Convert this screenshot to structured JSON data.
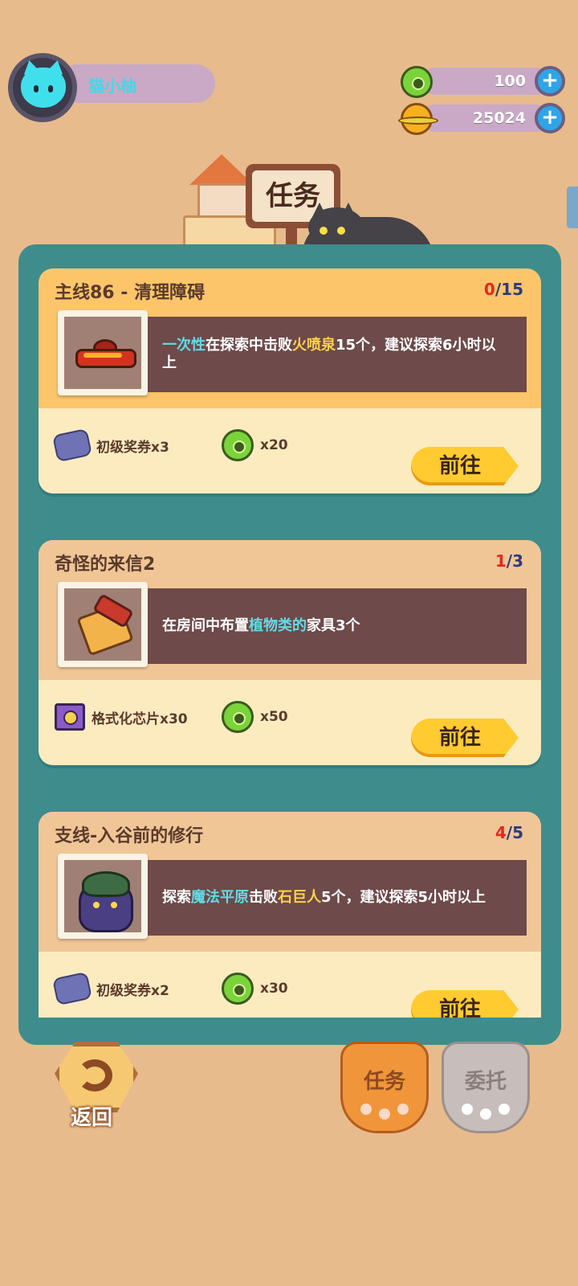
{
  "player": {
    "name": "猫小柚"
  },
  "currencies": [
    {
      "icon": "green-donut-coin-icon",
      "value": "100"
    },
    {
      "icon": "gold-planet-coin-icon",
      "value": "25024"
    }
  ],
  "header": {
    "sign_title": "任务"
  },
  "tasks": [
    {
      "title": "主线86 - 清理障碍",
      "progress_current": "0",
      "progress_sep": "/",
      "progress_total": "15",
      "item_icon": "fire-geyser-icon",
      "desc": [
        "一次性",
        "在探索中击败",
        "火喷泉",
        "15个，建议探索6小时以上"
      ],
      "rewards": [
        {
          "icon": "ticket-icon",
          "label": "初级奖券x3"
        },
        {
          "icon": "green-donut-coin-icon",
          "label": "x20"
        }
      ],
      "go_label": "前往"
    },
    {
      "title": "奇怪的来信2",
      "progress_current": "1",
      "progress_sep": "/",
      "progress_total": "3",
      "item_icon": "paint-roller-icon",
      "desc": [
        "在房间中布置",
        "植物类的",
        "家具3个"
      ],
      "rewards": [
        {
          "icon": "format-chip-icon",
          "label": "格式化芯片x30"
        },
        {
          "icon": "green-donut-coin-icon",
          "label": "x50"
        }
      ],
      "go_label": "前往"
    },
    {
      "title": "支线-入谷前的修行",
      "progress_current": "4",
      "progress_sep": "/",
      "progress_total": "5",
      "item_icon": "stone-golem-icon",
      "desc": [
        "探索",
        "魔法平原",
        "击败",
        "石巨人",
        "5个，建议探索5小时以上"
      ],
      "rewards": [
        {
          "icon": "ticket-icon",
          "label": "初级奖券x2"
        },
        {
          "icon": "green-donut-coin-icon",
          "label": "x30"
        }
      ],
      "go_label": "前往"
    }
  ],
  "nav": {
    "back_label": "返回",
    "task_label": "任务",
    "commission_label": "委托"
  },
  "colors": {
    "background": "#e8bb8c",
    "panel": "#3e8c8c",
    "progress_current": "#e8271f",
    "highlight_cyan": "#5fdde6",
    "highlight_yellow": "#ffd24a",
    "go_button": "#ffcb30"
  }
}
